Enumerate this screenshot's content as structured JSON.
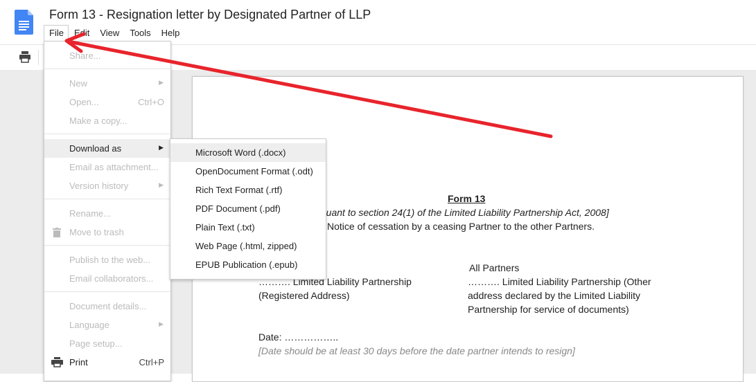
{
  "title": "Form 13 - Resignation letter by Designated Partner of LLP",
  "menu": [
    "File",
    "Edit",
    "View",
    "Tools",
    "Help"
  ],
  "file_menu": {
    "share": "Share...",
    "new": "New",
    "open": "Open...",
    "open_shortcut": "Ctrl+O",
    "make_copy": "Make a copy...",
    "download_as": "Download as",
    "email_attachment": "Email as attachment...",
    "version_history": "Version history",
    "rename": "Rename...",
    "move_to_trash": "Move to trash",
    "publish": "Publish to the web...",
    "email_collaborators": "Email collaborators...",
    "document_details": "Document details...",
    "language": "Language",
    "page_setup": "Page setup...",
    "print": "Print",
    "print_shortcut": "Ctrl+P"
  },
  "download_submenu": [
    "Microsoft Word (.docx)",
    "OpenDocument Format (.odt)",
    "Rich Text Format (.rtf)",
    "PDF Document (.pdf)",
    "Plain Text (.txt)",
    "Web Page (.html, zipped)",
    "EPUB Publication (.epub)"
  ],
  "document": {
    "form_title": "Form 13",
    "pursuant": "[Pursuant to section 24(1) of the Limited Liability Partnership Act, 2008]",
    "notice": "Notice of cessation by a ceasing Partner to the other Partners.",
    "all_partners": "All Partners",
    "llp_left": "………. Limited Liability Partnership",
    "registered_address": "(Registered Address)",
    "llp_right": "………. Limited Liability Partnership (Other",
    "right_line2": "address declared by the Limited Liability",
    "right_line3": "Partnership for service of documents)",
    "date": "Date: ……………..",
    "date_note": "[Date should be at least 30 days before the date partner intends to resign]"
  },
  "colors": {
    "docs_blue": "#4285f4",
    "annotation_red": "#e8242c",
    "disabled_text": "#bbbbbb",
    "highlight": "#eeeeee"
  },
  "icons": [
    "docs-logo-icon",
    "print-icon",
    "trash-icon",
    "submenu-arrow-icon"
  ]
}
